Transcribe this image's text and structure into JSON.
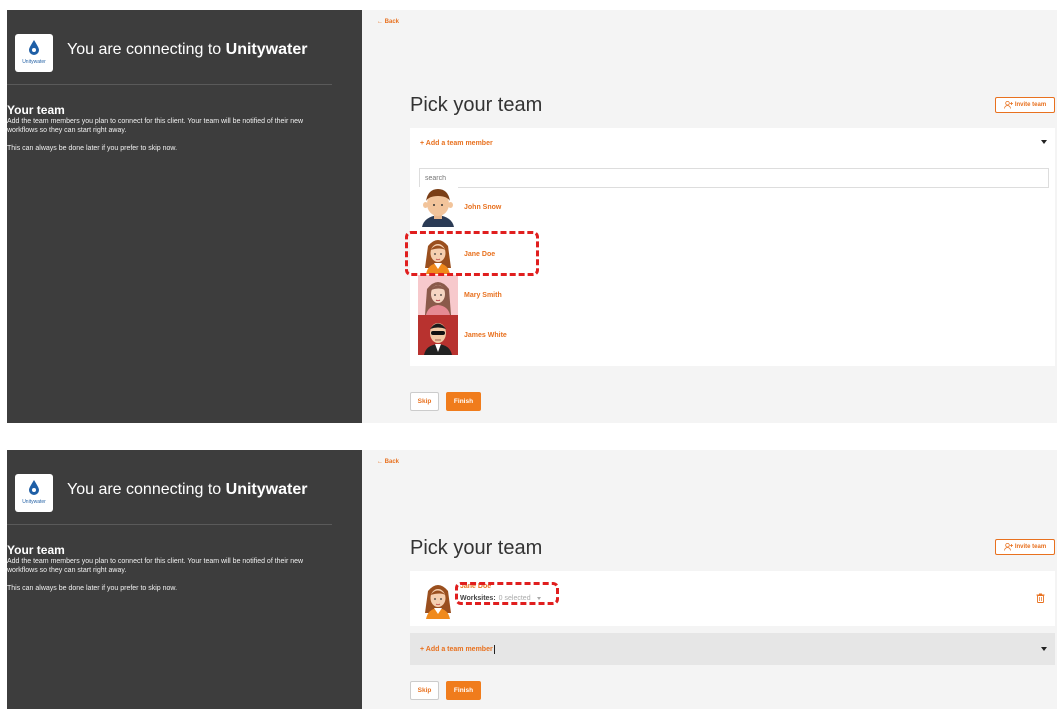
{
  "screens": [
    {
      "left": {
        "logo_text": "Unitywater",
        "connect_prefix": "You are connecting to ",
        "client_name": "Unitywater",
        "team_heading": "Your team",
        "team_description": "Add the team members you plan to connect for this client. Your team will be notified of their new workflows so they can start right away.",
        "team_note": "This can always be done later if you prefer to skip now."
      },
      "right": {
        "back_label": "← Back",
        "page_title": "Pick your team",
        "invite_label": "Invite team",
        "add_member_label": "+ Add a team member",
        "search_placeholder": "search",
        "members": [
          {
            "name": "John Snow",
            "avatar": "john-snow-avatar"
          },
          {
            "name": "Jane Doe",
            "avatar": "jane-doe-avatar"
          },
          {
            "name": "Mary Smith",
            "avatar": "mary-smith-avatar"
          },
          {
            "name": "James White",
            "avatar": "james-white-avatar"
          }
        ],
        "skip_label": "Skip",
        "finish_label": "Finish"
      }
    },
    {
      "left": {
        "logo_text": "Unitywater",
        "connect_prefix": "You are connecting to ",
        "client_name": "Unitywater",
        "team_heading": "Your team",
        "team_description": "Add the team members you plan to connect for this client. Your team will be notified of their new workflows so they can start right away.",
        "team_note": "This can always be done later if you prefer to skip now."
      },
      "right": {
        "back_label": "← Back",
        "page_title": "Pick your team",
        "invite_label": "Invite team",
        "selected_member": {
          "name": "Jane Doe",
          "worksites_label": "Worksites:",
          "worksites_value": "0 selected"
        },
        "add_member_label": "+ Add a team member",
        "skip_label": "Skip",
        "finish_label": "Finish"
      }
    }
  ],
  "colors": {
    "accent": "#e8711f",
    "sidebar": "#3d3d3d",
    "highlight": "#e01e1e"
  }
}
